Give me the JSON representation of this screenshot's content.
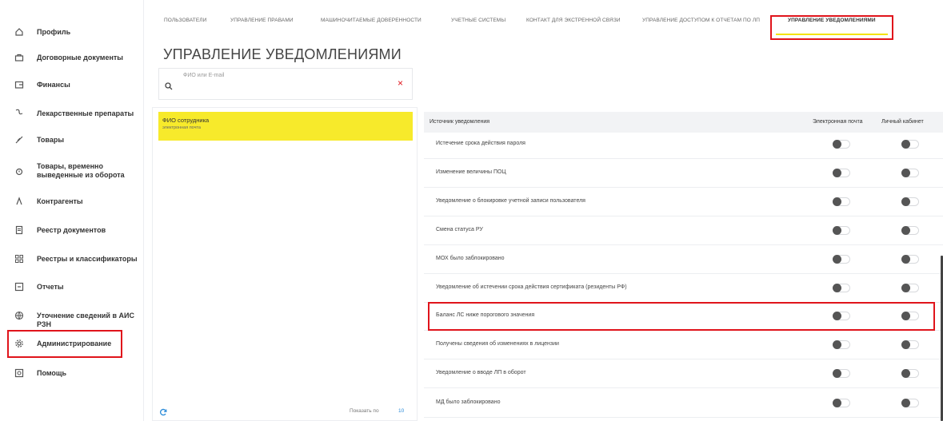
{
  "sidebar": {
    "items": [
      {
        "label": "Профиль",
        "icon": "home-icon"
      },
      {
        "label": "Договорные документы",
        "icon": "briefcase-icon"
      },
      {
        "label": "Финансы",
        "icon": "wallet-icon"
      },
      {
        "label": "Лекарственные препараты",
        "icon": "pills-icon"
      },
      {
        "label": "Товары",
        "icon": "tag-icon"
      },
      {
        "label": "Товары, временно выведенные из оборота",
        "icon": "withdrawn-icon"
      },
      {
        "label": "Контрагенты",
        "icon": "person-icon"
      },
      {
        "label": "Реестр документов",
        "icon": "document-icon"
      },
      {
        "label": "Реестры и классификаторы",
        "icon": "grid-icon"
      },
      {
        "label": "Отчеты",
        "icon": "report-icon"
      },
      {
        "label": "Уточнение сведений в АИС РЗН",
        "icon": "globe-icon"
      },
      {
        "label": "Администрирование",
        "icon": "gear-icon"
      },
      {
        "label": "Помощь",
        "icon": "help-icon"
      }
    ]
  },
  "tabs": [
    {
      "label": "Пользователи"
    },
    {
      "label": "Управление правами"
    },
    {
      "label": "Машиночитаемые доверенности"
    },
    {
      "label": "Учетные системы"
    },
    {
      "label": "Контакт для экстренной связи"
    },
    {
      "label": "Управление доступом к отчетам по ЛП"
    },
    {
      "label": "Управление уведомлениями"
    }
  ],
  "page_title": "УПРАВЛЕНИЕ УВЕДОМЛЕНИЯМИ",
  "search": {
    "placeholder": "ФИО или E-mail",
    "clear": "×"
  },
  "employee": {
    "name": "ФИО сотрудника",
    "subtitle": "электронная почта"
  },
  "list_footer": {
    "page_size_label": "Показать по",
    "page_size_value": "10"
  },
  "table": {
    "columns": [
      "Источник уведомления",
      "Электронная почта",
      "Личный кабинет"
    ],
    "rows": [
      {
        "label": "Истечение срока действия пароля",
        "email": false,
        "cabinet": false
      },
      {
        "label": "Изменение величины ПОЦ",
        "email": false,
        "cabinet": false
      },
      {
        "label": "Уведомление о блокировке учетной записи пользователя",
        "email": false,
        "cabinet": false
      },
      {
        "label": "Смена статуса РУ",
        "email": false,
        "cabinet": false
      },
      {
        "label": "МОХ было заблокировано",
        "email": false,
        "cabinet": false
      },
      {
        "label": "Уведомление об истечении срока действия сертификата (резиденты РФ)",
        "email": false,
        "cabinet": false
      },
      {
        "label": "Баланс ЛС ниже порогового значения",
        "email": false,
        "cabinet": false
      },
      {
        "label": "Получены сведения об изменениях в лицензии",
        "email": false,
        "cabinet": false
      },
      {
        "label": "Уведомление о вводе ЛП в оборот",
        "email": false,
        "cabinet": false
      },
      {
        "label": "МД было заблокировано",
        "email": false,
        "cabinet": false
      }
    ]
  },
  "colors": {
    "accent_yellow": "#f7ea2b",
    "highlight_red": "#e0141b",
    "link_blue": "#2a8bd9"
  }
}
